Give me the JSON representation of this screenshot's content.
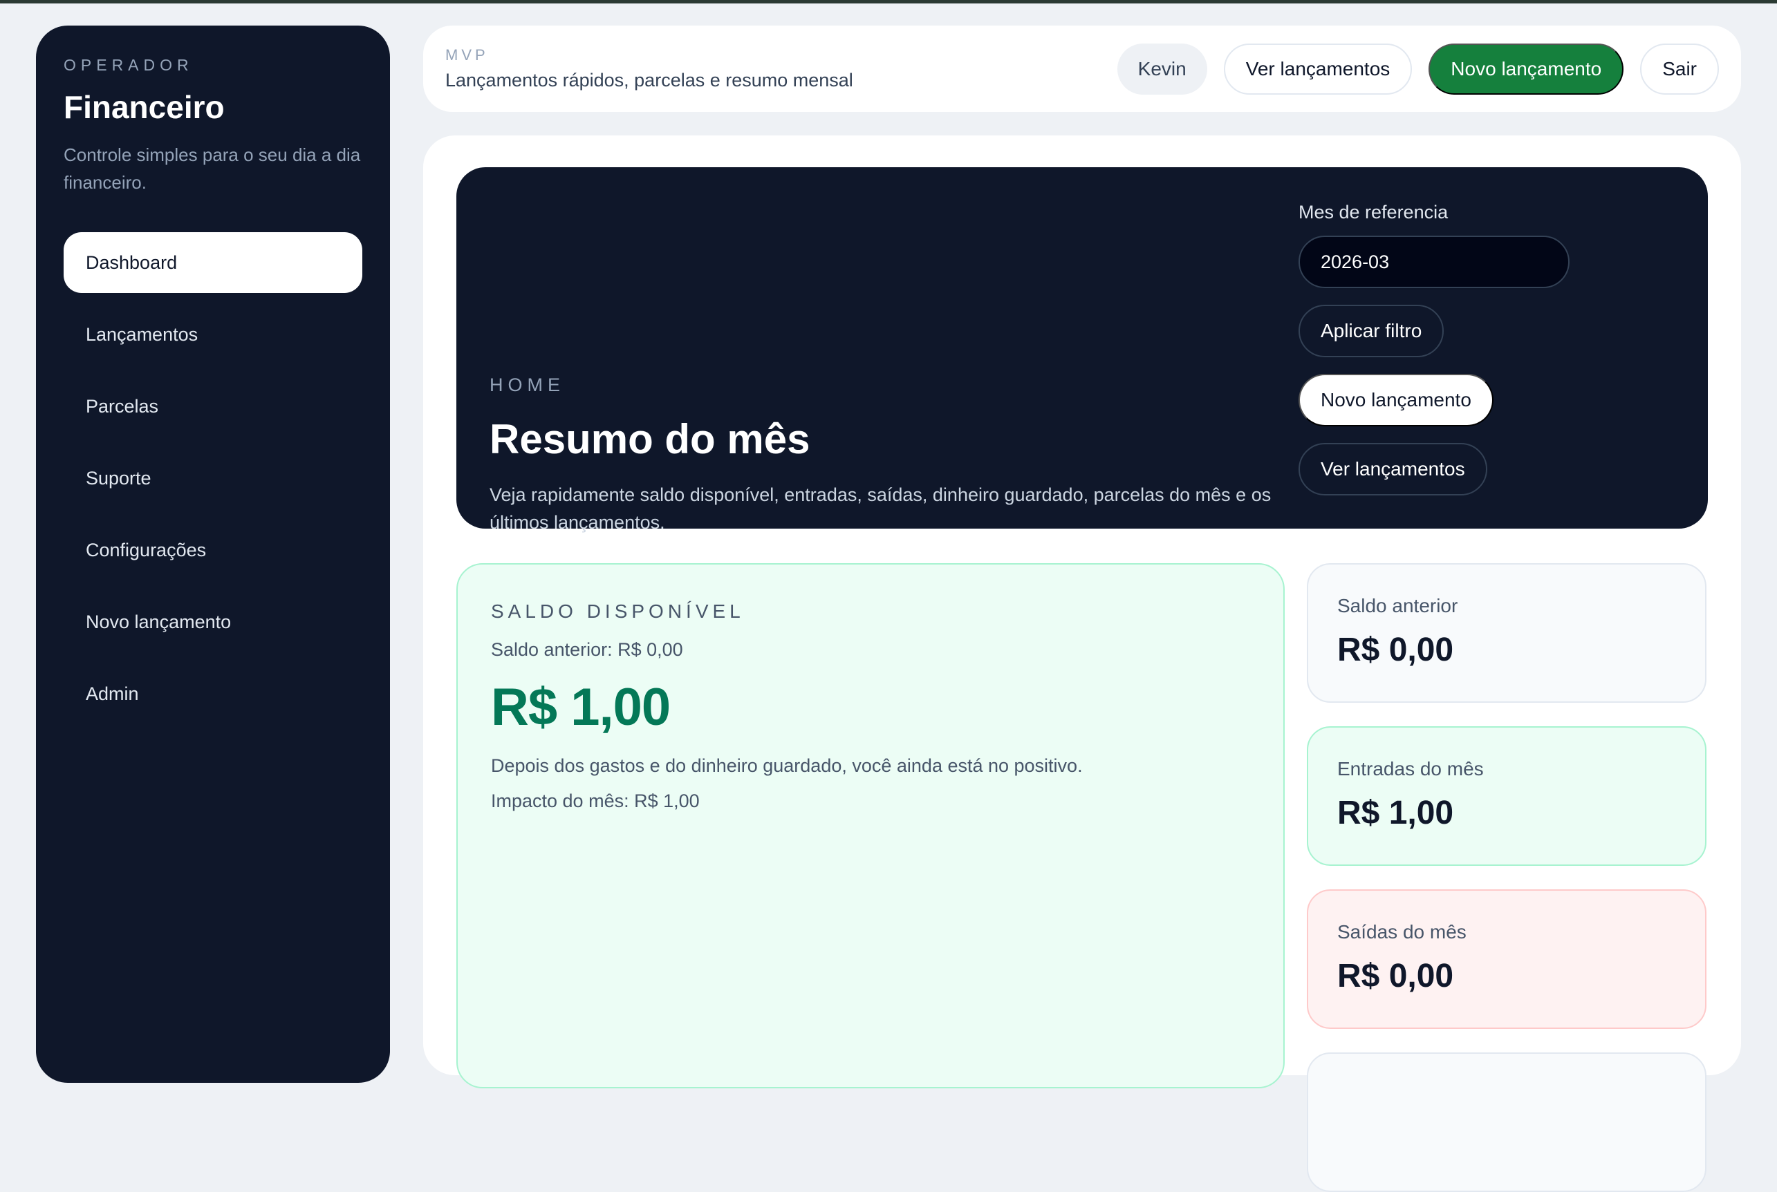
{
  "sidebar": {
    "eyebrow": "OPERADOR",
    "title": "Financeiro",
    "description": "Controle simples para o seu dia a dia financeiro.",
    "items": [
      {
        "label": "Dashboard",
        "active": true
      },
      {
        "label": "Lançamentos"
      },
      {
        "label": "Parcelas"
      },
      {
        "label": "Suporte"
      },
      {
        "label": "Configurações"
      },
      {
        "label": "Novo lançamento"
      },
      {
        "label": "Admin"
      }
    ]
  },
  "topbar": {
    "eyebrow": "MVP",
    "subtitle": "Lançamentos rápidos, parcelas e resumo mensal",
    "user": "Kevin",
    "view_entries": "Ver lançamentos",
    "new_entry": "Novo lançamento",
    "logout": "Sair"
  },
  "hero": {
    "eyebrow": "HOME",
    "title": "Resumo do mês",
    "description": "Veja rapidamente saldo disponível, entradas, saídas, dinheiro guardado, parcelas do mês e os últimos lançamentos.",
    "month_label": "Mes de referencia",
    "month_value": "2026-03",
    "apply_filter": "Aplicar filtro",
    "new_entry": "Novo lançamento",
    "view_entries": "Ver lançamentos"
  },
  "balance": {
    "eyebrow": "SALDO DISPONÍVEL",
    "previous": "Saldo anterior: R$ 0,00",
    "value": "R$ 1,00",
    "note": "Depois dos gastos e do dinheiro guardado, você ainda está no positivo.",
    "impact": "Impacto do mês: R$ 1,00"
  },
  "stats": {
    "previous": {
      "label": "Saldo anterior",
      "value": "R$ 0,00"
    },
    "income": {
      "label": "Entradas do mês",
      "value": "R$ 1,00"
    },
    "expense": {
      "label": "Saídas do mês",
      "value": "R$ 0,00"
    }
  },
  "colors": {
    "sidebar_bg": "#0f172a",
    "accent_green": "#15803d",
    "balance_green": "#047857",
    "page_bg": "#eef1f5"
  }
}
